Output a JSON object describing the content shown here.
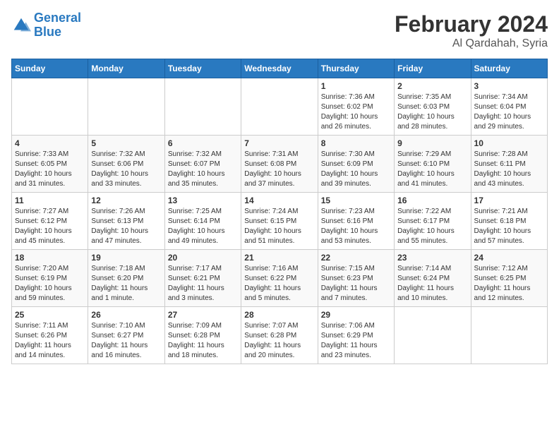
{
  "header": {
    "logo_line1": "General",
    "logo_line2": "Blue",
    "title": "February 2024",
    "subtitle": "Al Qardahah, Syria"
  },
  "calendar": {
    "days_of_week": [
      "Sunday",
      "Monday",
      "Tuesday",
      "Wednesday",
      "Thursday",
      "Friday",
      "Saturday"
    ],
    "weeks": [
      [
        {
          "day": "",
          "info": ""
        },
        {
          "day": "",
          "info": ""
        },
        {
          "day": "",
          "info": ""
        },
        {
          "day": "",
          "info": ""
        },
        {
          "day": "1",
          "info": "Sunrise: 7:36 AM\nSunset: 6:02 PM\nDaylight: 10 hours\nand 26 minutes."
        },
        {
          "day": "2",
          "info": "Sunrise: 7:35 AM\nSunset: 6:03 PM\nDaylight: 10 hours\nand 28 minutes."
        },
        {
          "day": "3",
          "info": "Sunrise: 7:34 AM\nSunset: 6:04 PM\nDaylight: 10 hours\nand 29 minutes."
        }
      ],
      [
        {
          "day": "4",
          "info": "Sunrise: 7:33 AM\nSunset: 6:05 PM\nDaylight: 10 hours\nand 31 minutes."
        },
        {
          "day": "5",
          "info": "Sunrise: 7:32 AM\nSunset: 6:06 PM\nDaylight: 10 hours\nand 33 minutes."
        },
        {
          "day": "6",
          "info": "Sunrise: 7:32 AM\nSunset: 6:07 PM\nDaylight: 10 hours\nand 35 minutes."
        },
        {
          "day": "7",
          "info": "Sunrise: 7:31 AM\nSunset: 6:08 PM\nDaylight: 10 hours\nand 37 minutes."
        },
        {
          "day": "8",
          "info": "Sunrise: 7:30 AM\nSunset: 6:09 PM\nDaylight: 10 hours\nand 39 minutes."
        },
        {
          "day": "9",
          "info": "Sunrise: 7:29 AM\nSunset: 6:10 PM\nDaylight: 10 hours\nand 41 minutes."
        },
        {
          "day": "10",
          "info": "Sunrise: 7:28 AM\nSunset: 6:11 PM\nDaylight: 10 hours\nand 43 minutes."
        }
      ],
      [
        {
          "day": "11",
          "info": "Sunrise: 7:27 AM\nSunset: 6:12 PM\nDaylight: 10 hours\nand 45 minutes."
        },
        {
          "day": "12",
          "info": "Sunrise: 7:26 AM\nSunset: 6:13 PM\nDaylight: 10 hours\nand 47 minutes."
        },
        {
          "day": "13",
          "info": "Sunrise: 7:25 AM\nSunset: 6:14 PM\nDaylight: 10 hours\nand 49 minutes."
        },
        {
          "day": "14",
          "info": "Sunrise: 7:24 AM\nSunset: 6:15 PM\nDaylight: 10 hours\nand 51 minutes."
        },
        {
          "day": "15",
          "info": "Sunrise: 7:23 AM\nSunset: 6:16 PM\nDaylight: 10 hours\nand 53 minutes."
        },
        {
          "day": "16",
          "info": "Sunrise: 7:22 AM\nSunset: 6:17 PM\nDaylight: 10 hours\nand 55 minutes."
        },
        {
          "day": "17",
          "info": "Sunrise: 7:21 AM\nSunset: 6:18 PM\nDaylight: 10 hours\nand 57 minutes."
        }
      ],
      [
        {
          "day": "18",
          "info": "Sunrise: 7:20 AM\nSunset: 6:19 PM\nDaylight: 10 hours\nand 59 minutes."
        },
        {
          "day": "19",
          "info": "Sunrise: 7:18 AM\nSunset: 6:20 PM\nDaylight: 11 hours\nand 1 minute."
        },
        {
          "day": "20",
          "info": "Sunrise: 7:17 AM\nSunset: 6:21 PM\nDaylight: 11 hours\nand 3 minutes."
        },
        {
          "day": "21",
          "info": "Sunrise: 7:16 AM\nSunset: 6:22 PM\nDaylight: 11 hours\nand 5 minutes."
        },
        {
          "day": "22",
          "info": "Sunrise: 7:15 AM\nSunset: 6:23 PM\nDaylight: 11 hours\nand 7 minutes."
        },
        {
          "day": "23",
          "info": "Sunrise: 7:14 AM\nSunset: 6:24 PM\nDaylight: 11 hours\nand 10 minutes."
        },
        {
          "day": "24",
          "info": "Sunrise: 7:12 AM\nSunset: 6:25 PM\nDaylight: 11 hours\nand 12 minutes."
        }
      ],
      [
        {
          "day": "25",
          "info": "Sunrise: 7:11 AM\nSunset: 6:26 PM\nDaylight: 11 hours\nand 14 minutes."
        },
        {
          "day": "26",
          "info": "Sunrise: 7:10 AM\nSunset: 6:27 PM\nDaylight: 11 hours\nand 16 minutes."
        },
        {
          "day": "27",
          "info": "Sunrise: 7:09 AM\nSunset: 6:28 PM\nDaylight: 11 hours\nand 18 minutes."
        },
        {
          "day": "28",
          "info": "Sunrise: 7:07 AM\nSunset: 6:28 PM\nDaylight: 11 hours\nand 20 minutes."
        },
        {
          "day": "29",
          "info": "Sunrise: 7:06 AM\nSunset: 6:29 PM\nDaylight: 11 hours\nand 23 minutes."
        },
        {
          "day": "",
          "info": ""
        },
        {
          "day": "",
          "info": ""
        }
      ]
    ]
  }
}
